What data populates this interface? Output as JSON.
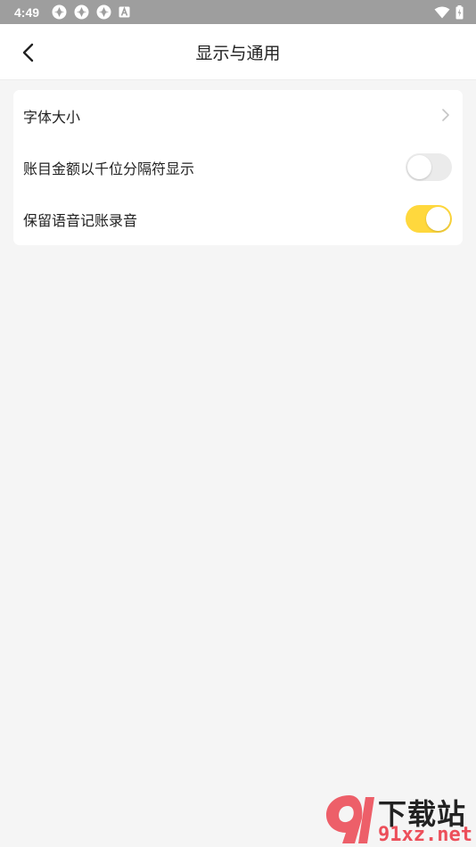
{
  "status_bar": {
    "time": "4:49",
    "icons": [
      "app-icon",
      "app-icon",
      "app-icon",
      "a-icon"
    ],
    "right_icons": [
      "wifi-icon",
      "battery-icon"
    ],
    "color": "#9e9e9e"
  },
  "header": {
    "title": "显示与通用",
    "back_icon": "chevron-left-icon"
  },
  "settings": {
    "items": [
      {
        "label": "字体大小",
        "control": "chevron-right-icon"
      },
      {
        "label": "账目金额以千位分隔符显示",
        "control": "toggle",
        "enabled": false
      },
      {
        "label": "保留语音记账录音",
        "control": "toggle",
        "enabled": true
      }
    ]
  },
  "colors": {
    "toggle_on": "#ffd83d",
    "toggle_off": "#ebebeb",
    "background": "#f5f5f5"
  },
  "watermark": {
    "line1": "下载站",
    "line2": "91xz.net"
  }
}
